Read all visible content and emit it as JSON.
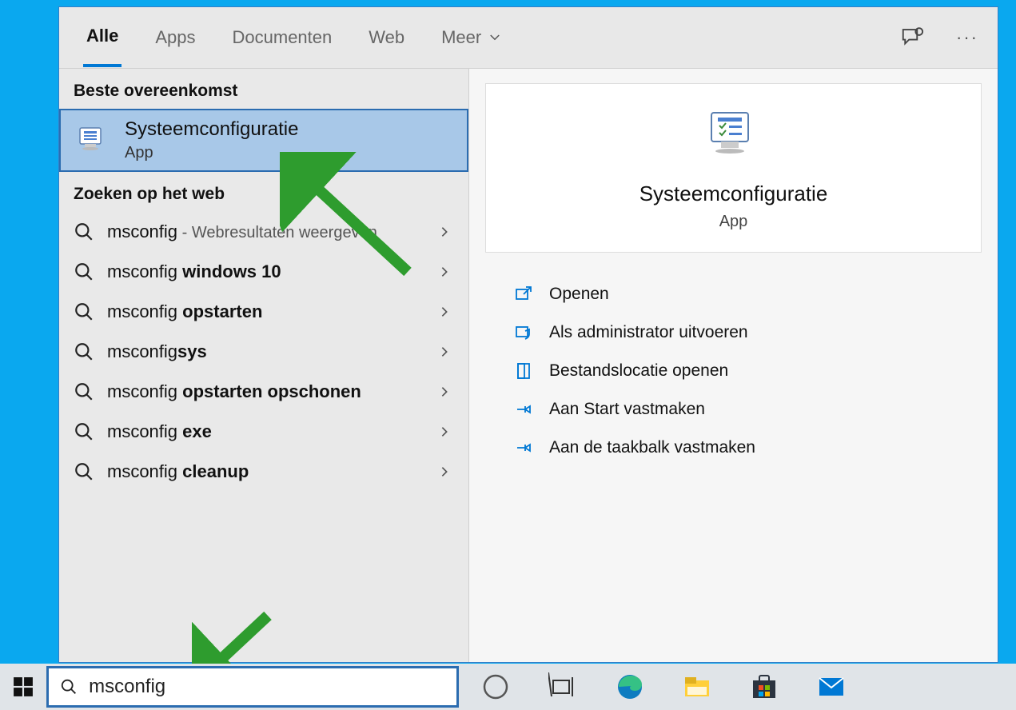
{
  "tabs": {
    "alle": "Alle",
    "apps": "Apps",
    "documenten": "Documenten",
    "web": "Web",
    "meer": "Meer"
  },
  "left": {
    "best_match_header": "Beste overeenkomst",
    "best_match": {
      "title": "Systeemconfiguratie",
      "sub": "App"
    },
    "web_header": "Zoeken op het web",
    "results": [
      {
        "prefix": "msconfig",
        "suffix": " - Webresultaten weergeven",
        "bold": "",
        "hint": true
      },
      {
        "prefix": "msconfig ",
        "bold": "windows 10"
      },
      {
        "prefix": "msconfig ",
        "bold": "opstarten"
      },
      {
        "prefix": "msconfig",
        "bold": "sys"
      },
      {
        "prefix": "msconfig ",
        "bold": "opstarten opschonen"
      },
      {
        "prefix": "msconfig ",
        "bold": "exe"
      },
      {
        "prefix": "msconfig ",
        "bold": "cleanup"
      }
    ]
  },
  "detail": {
    "title": "Systeemconfiguratie",
    "sub": "App",
    "actions": {
      "open": "Openen",
      "admin": "Als administrator uitvoeren",
      "filelocation": "Bestandslocatie openen",
      "pinstart": "Aan Start vastmaken",
      "pintaskbar": "Aan de taakbalk vastmaken"
    }
  },
  "searchbox": {
    "value": "msconfig"
  }
}
